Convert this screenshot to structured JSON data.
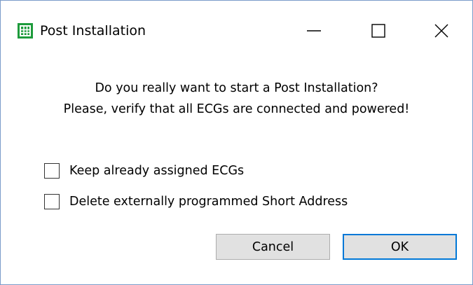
{
  "window": {
    "title": "Post Installation",
    "app_icon": "grid-app-icon",
    "controls": {
      "minimize": "minimize-icon",
      "maximize": "maximize-icon",
      "close": "close-icon"
    }
  },
  "dialog": {
    "message_line1": "Do you really want to start a Post Installation?",
    "message_line2": "Please, verify that all ECGs are connected and powered!",
    "options": [
      {
        "label": "Keep already assigned ECGs",
        "checked": false
      },
      {
        "label": "Delete externally programmed Short Address",
        "checked": false
      }
    ],
    "buttons": {
      "cancel_label": "Cancel",
      "ok_label": "OK"
    }
  },
  "colors": {
    "app_icon_green": "#1e9b3c",
    "window_border": "#7a9cc9",
    "button_face": "#e1e1e1",
    "default_button_border": "#0078d7"
  }
}
